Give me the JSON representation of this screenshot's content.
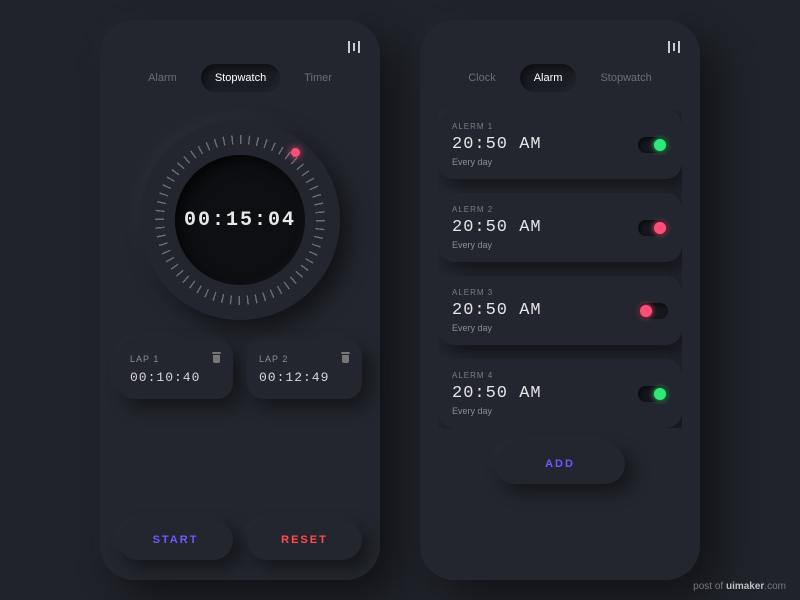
{
  "credit": {
    "prefix": "post of ",
    "site": "uimaker",
    "suffix": ".com"
  },
  "stopwatch": {
    "tabs": [
      "Alarm",
      "Stopwatch",
      "Timer"
    ],
    "activeTab": 1,
    "time": "00:15:04",
    "laps": [
      {
        "label": "LAP 1",
        "time": "00:10:40"
      },
      {
        "label": "LAP 2",
        "time": "00:12:49"
      }
    ],
    "buttons": {
      "start": "START",
      "reset": "RESET"
    },
    "accent": "#ff4d7a"
  },
  "alarm": {
    "tabs": [
      "Clock",
      "Alarm",
      "Stopwatch"
    ],
    "activeTab": 1,
    "items": [
      {
        "label": "ALERM 1",
        "time": "20:50 AM",
        "repeat": "Every  day",
        "on": true,
        "color": "green"
      },
      {
        "label": "ALERM 2",
        "time": "20:50 AM",
        "repeat": "Every  day",
        "on": true,
        "color": "pink"
      },
      {
        "label": "ALERM 3",
        "time": "20:50 AM",
        "repeat": "Every  day",
        "on": false,
        "color": "pink"
      },
      {
        "label": "ALERM 4",
        "time": "20:50 AM",
        "repeat": "Every  day",
        "on": true,
        "color": "green"
      }
    ],
    "buttons": {
      "add": "ADD"
    }
  }
}
